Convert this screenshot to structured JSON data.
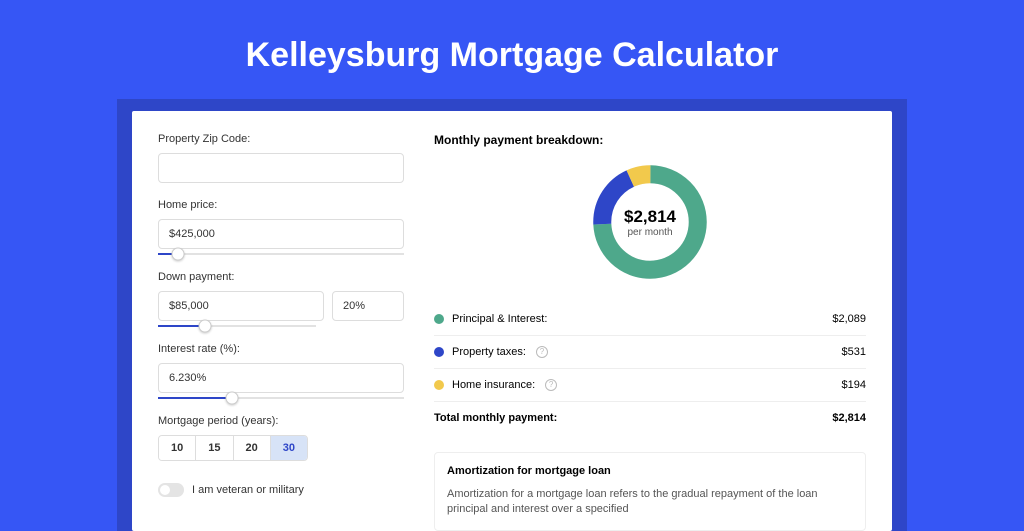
{
  "title": "Kelleysburg Mortgage Calculator",
  "left": {
    "zip_label": "Property Zip Code:",
    "zip_value": "",
    "price_label": "Home price:",
    "price_value": "$425,000",
    "down_label": "Down payment:",
    "down_amount": "$85,000",
    "down_pct": "20%",
    "rate_label": "Interest rate (%):",
    "rate_value": "6.230%",
    "period_label": "Mortgage period (years):",
    "period_options": [
      "10",
      "15",
      "20",
      "30"
    ],
    "period_selected": "30",
    "veteran_label": "I am veteran or military"
  },
  "right": {
    "heading": "Monthly payment breakdown:",
    "center_amount": "$2,814",
    "center_sub": "per month",
    "pi_label": "Principal & Interest:",
    "pi_value": "$2,089",
    "tax_label": "Property taxes:",
    "tax_value": "$531",
    "ins_label": "Home insurance:",
    "ins_value": "$194",
    "total_label": "Total monthly payment:",
    "total_value": "$2,814",
    "amort_heading": "Amortization for mortgage loan",
    "amort_text": "Amortization for a mortgage loan refers to the gradual repayment of the loan principal and interest over a specified"
  },
  "chart_data": {
    "type": "pie",
    "title": "Monthly payment breakdown",
    "series": [
      {
        "name": "Principal & Interest",
        "value": 2089,
        "color": "#4EA88B"
      },
      {
        "name": "Property taxes",
        "value": 531,
        "color": "#2E46C8"
      },
      {
        "name": "Home insurance",
        "value": 194,
        "color": "#F2C94C"
      }
    ],
    "total": 2814,
    "donut_inner_ratio": 0.62
  },
  "colors": {
    "green": "#4EA88B",
    "blue": "#2E46C8",
    "yellow": "#F2C94C",
    "bg": "#3656F5"
  }
}
